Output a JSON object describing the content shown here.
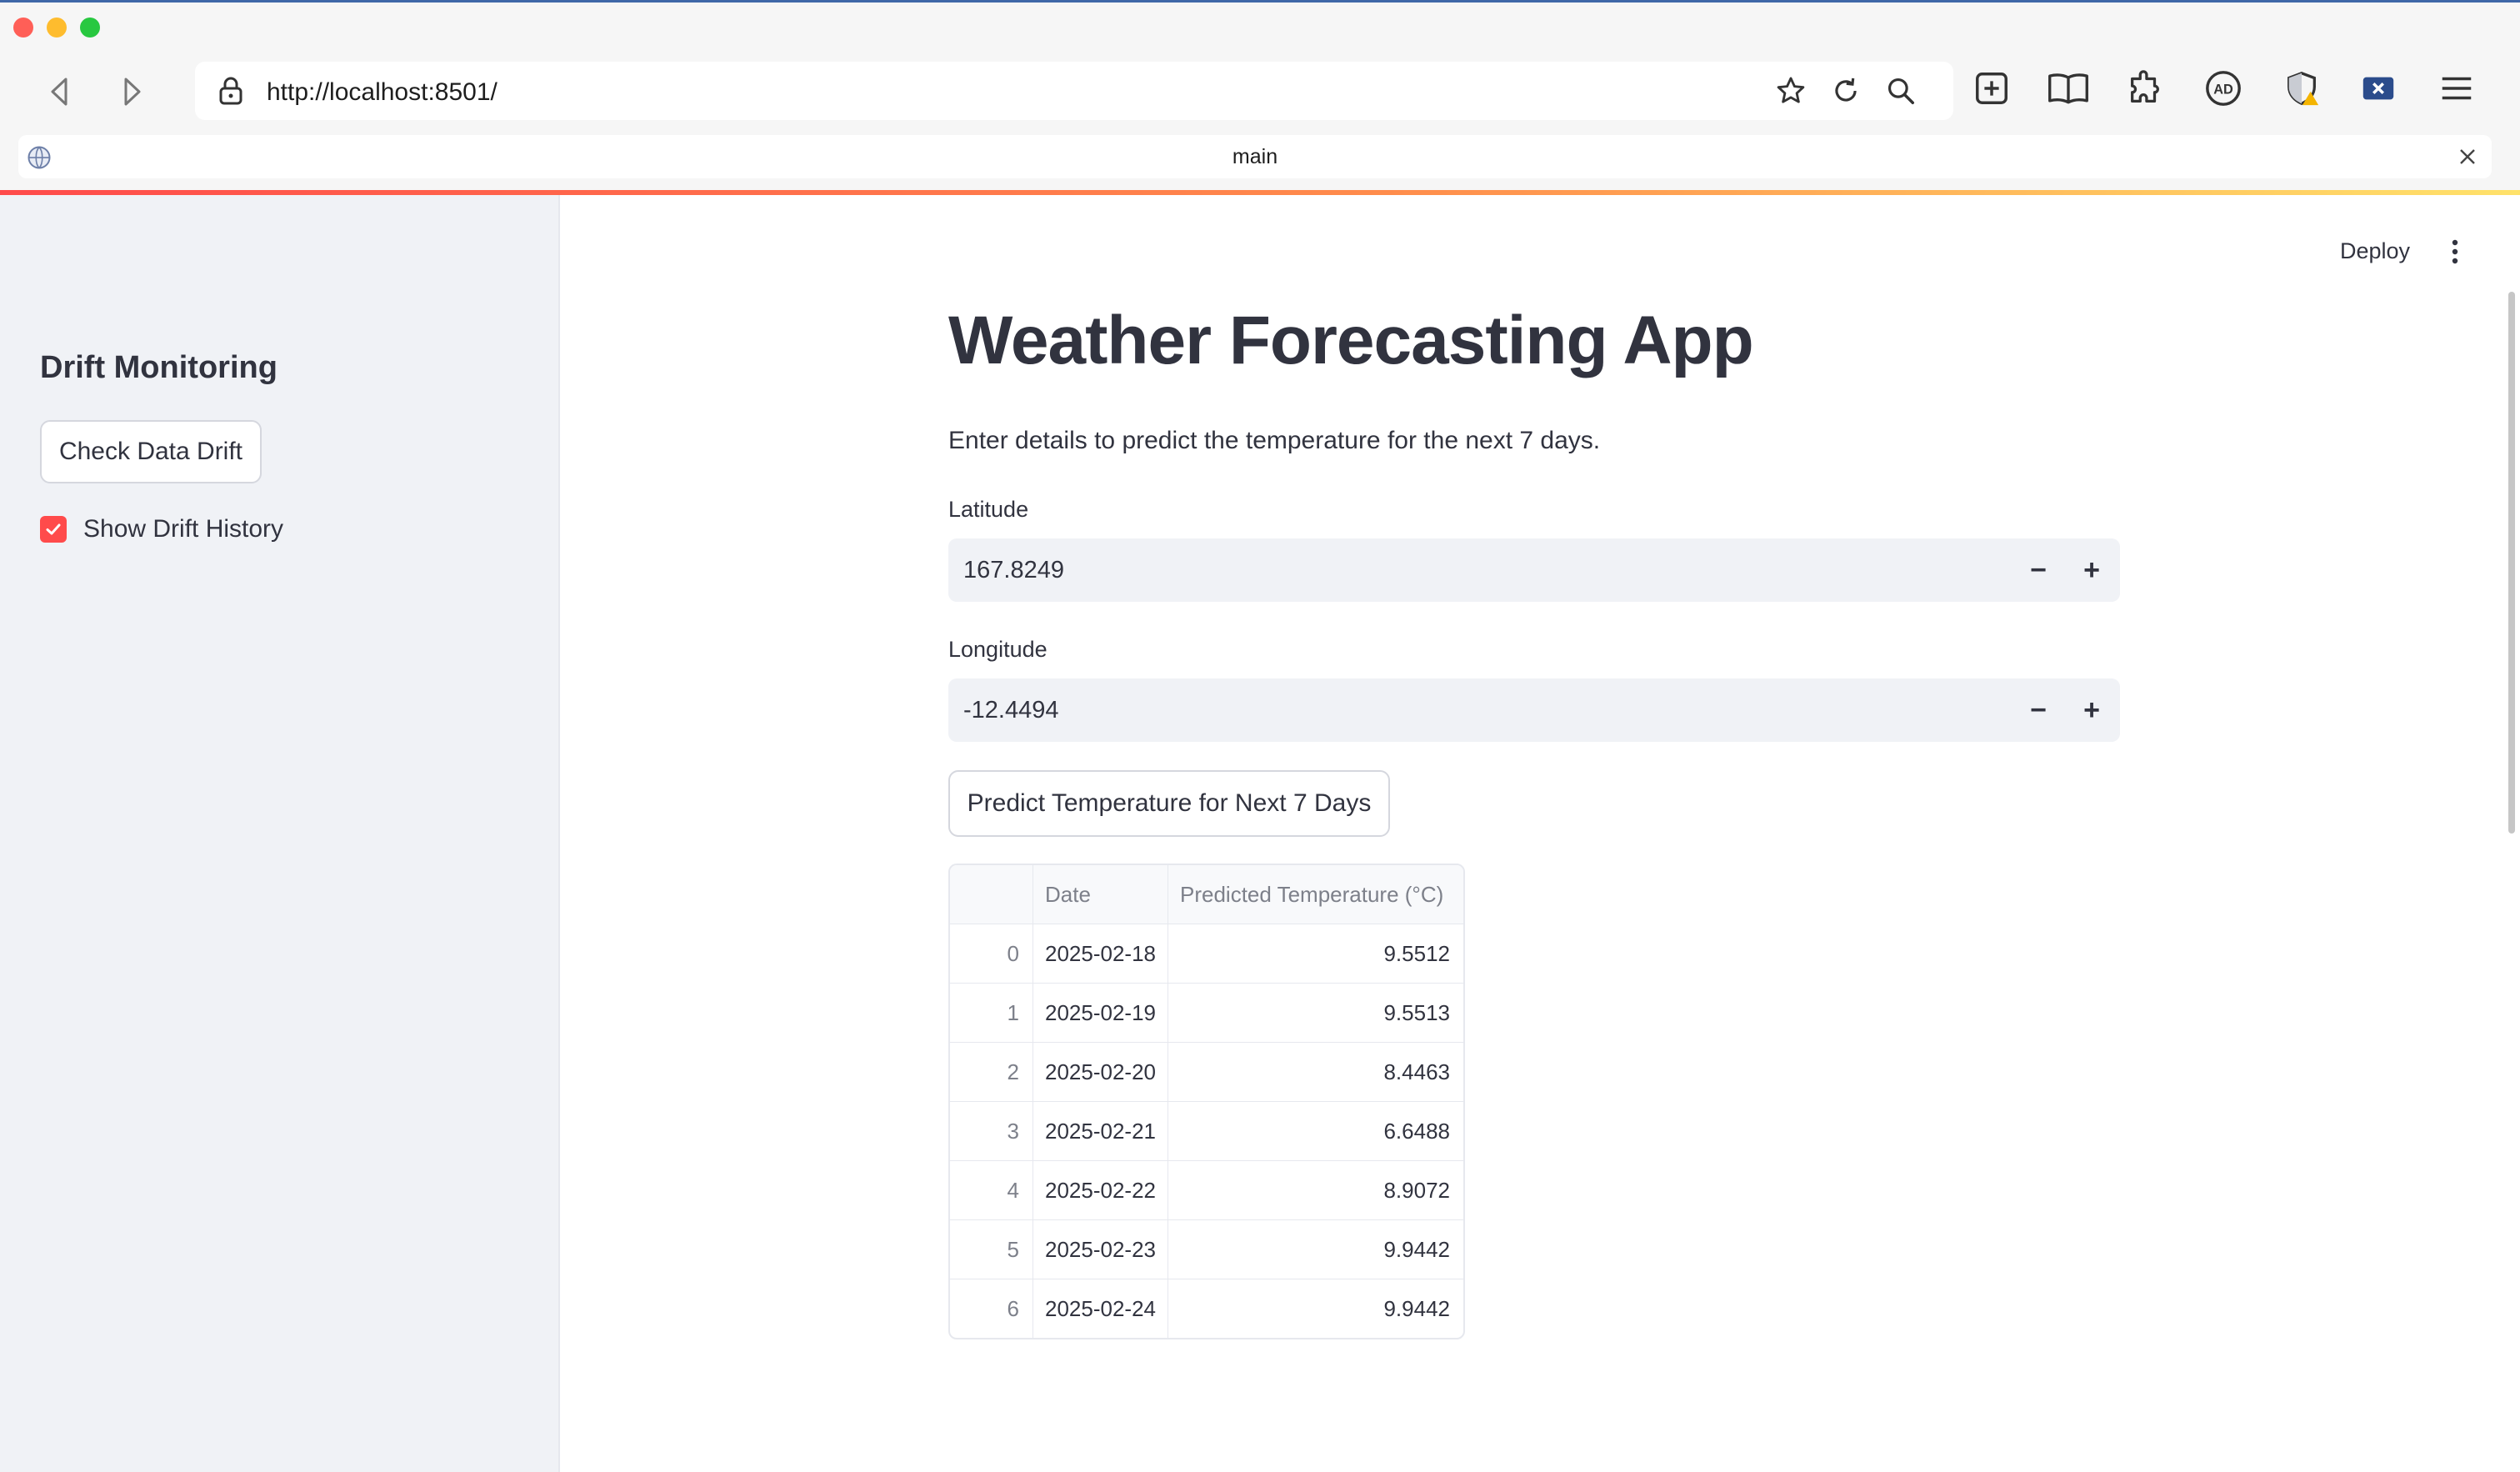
{
  "browser": {
    "url": "http://localhost:8501/",
    "tab_title": "main"
  },
  "sidebar": {
    "title": "Drift Monitoring",
    "check_button": "Check Data Drift",
    "show_history_label": "Show Drift History",
    "show_history_checked": true
  },
  "header": {
    "deploy_label": "Deploy"
  },
  "main": {
    "title": "Weather Forecasting App",
    "subtitle": "Enter details to predict the temperature for the next 7 days.",
    "latitude_label": "Latitude",
    "latitude_value": "167.8249",
    "longitude_label": "Longitude",
    "longitude_value": "-12.4494",
    "predict_button": "Predict Temperature for Next 7 Days",
    "minus": "−",
    "plus": "+"
  },
  "table": {
    "columns": [
      "",
      "Date",
      "Predicted Temperature (°C)"
    ],
    "rows": [
      {
        "idx": "0",
        "date": "2025-02-18",
        "temp": "9.5512"
      },
      {
        "idx": "1",
        "date": "2025-02-19",
        "temp": "9.5513"
      },
      {
        "idx": "2",
        "date": "2025-02-20",
        "temp": "8.4463"
      },
      {
        "idx": "3",
        "date": "2025-02-21",
        "temp": "6.6488"
      },
      {
        "idx": "4",
        "date": "2025-02-22",
        "temp": "8.9072"
      },
      {
        "idx": "5",
        "date": "2025-02-23",
        "temp": "9.9442"
      },
      {
        "idx": "6",
        "date": "2025-02-24",
        "temp": "9.9442"
      }
    ]
  },
  "colors": {
    "accent": "#ff4b4b",
    "sidebar_bg": "#f0f2f6",
    "text": "#31333f"
  }
}
